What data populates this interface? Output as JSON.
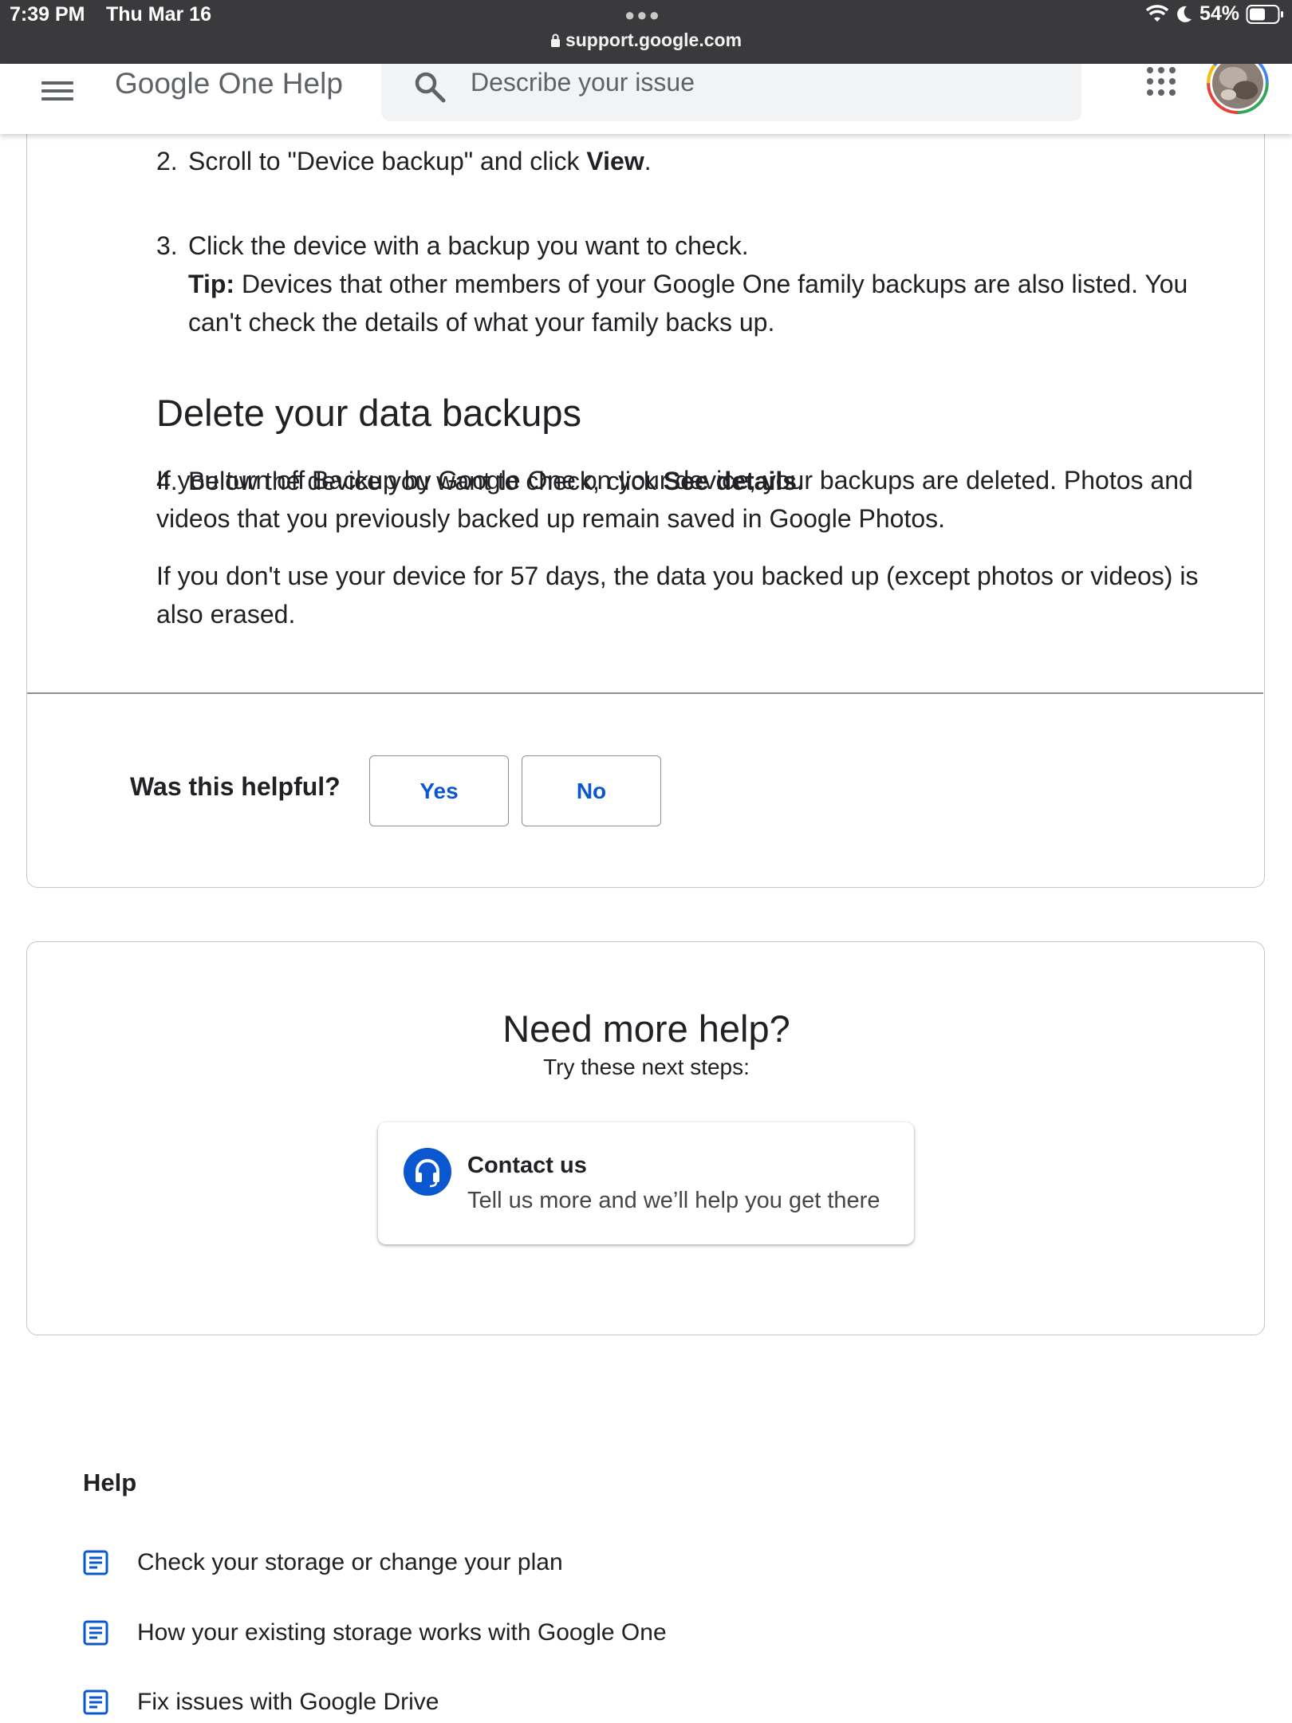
{
  "status_bar": {
    "time": "7:39 PM",
    "date": "Thu Mar 16",
    "battery": "54%",
    "url": "support.google.com"
  },
  "header": {
    "title": "Google One Help",
    "search_placeholder": "Describe your issue"
  },
  "article": {
    "steps": [
      {
        "num": "2.",
        "text_before": "Scroll to \"Device backup\" and click ",
        "bold": "View",
        "text_after": "."
      },
      {
        "num": "3.",
        "text": "Click the device with a backup you want to check.",
        "tip_label": "Tip:",
        "tip_text": " Devices that other members of your Google One family backups are also listed. You can't check the details of what your family backs up."
      },
      {
        "num": "4.",
        "text_before": "Below the device you want to check, click ",
        "bold": "See details",
        "text_after": "."
      }
    ],
    "section_title": "Delete your data backups",
    "paragraphs": [
      "If you turn off Backup by Google One on your device, your backups are deleted. Photos and videos that you previously backed up remain saved in Google Photos.",
      "If you don't use your device for 57 days, the data you backed up (except photos or videos) is also erased."
    ]
  },
  "feedback": {
    "question": "Was this helpful?",
    "yes": "Yes",
    "no": "No"
  },
  "more_help": {
    "title": "Need more help?",
    "subtitle": "Try these next steps:",
    "contact_title": "Contact us",
    "contact_desc": "Tell us more and we’ll help you get there"
  },
  "help_section": {
    "heading": "Help",
    "links": [
      "Check your storage or change your plan",
      "How your existing storage works with Google One",
      "Fix issues with Google Drive"
    ]
  },
  "colors": {
    "accent": "#0b57d0",
    "status_bar": "#3a3a3c",
    "search_bg": "#f1f3f4"
  }
}
